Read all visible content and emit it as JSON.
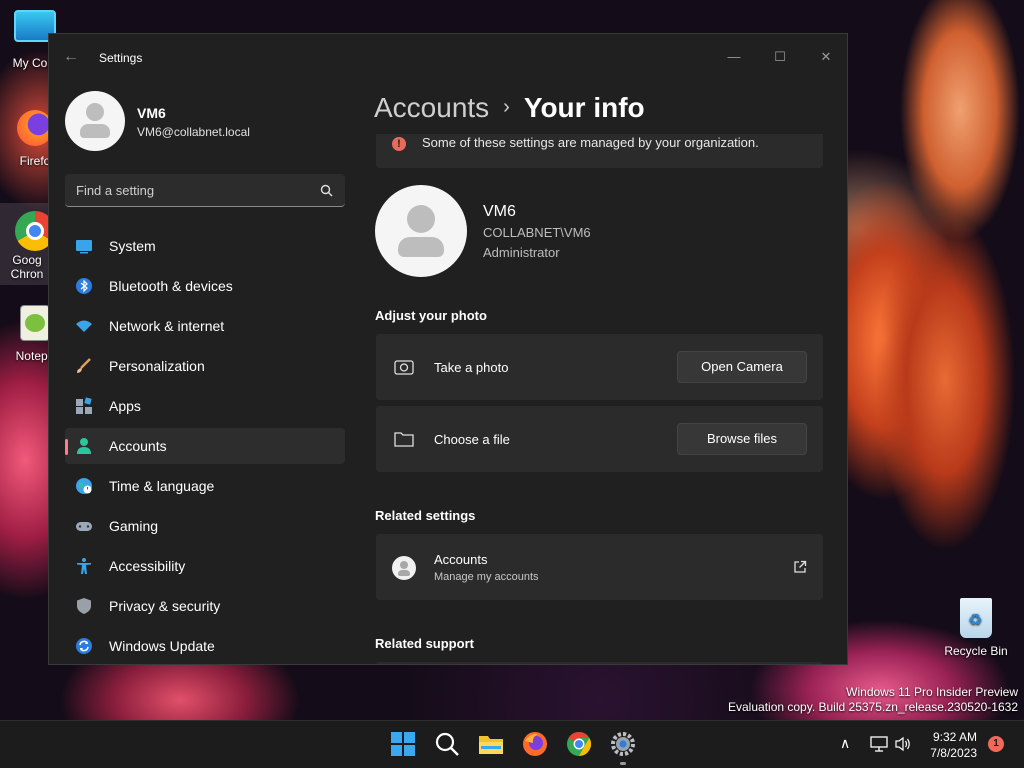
{
  "desktop": {
    "icons": [
      {
        "label": "My Com",
        "icon": "monitor-icon"
      },
      {
        "label": "Firefo",
        "icon": "firefox-icon"
      },
      {
        "label": "Goog",
        "label2": "Chron",
        "icon": "chrome-icon"
      },
      {
        "label": "Notepa",
        "icon": "notepad-icon"
      },
      {
        "label": "Recycle Bin",
        "icon": "recycle-bin-icon"
      }
    ],
    "watermark": {
      "line1": "Windows 11 Pro Insider Preview",
      "line2": "Evaluation copy. Build 25375.zn_release.230520-1632"
    }
  },
  "window": {
    "title": "Settings",
    "controls": {
      "minimize": "—",
      "maximize": "☐",
      "close": "✕"
    }
  },
  "profile": {
    "name": "VM6",
    "email": "VM6@collabnet.local"
  },
  "search": {
    "placeholder": "Find a setting"
  },
  "nav": {
    "items": [
      {
        "label": "System",
        "icon": "system-icon"
      },
      {
        "label": "Bluetooth & devices",
        "icon": "bluetooth-icon"
      },
      {
        "label": "Network & internet",
        "icon": "wifi-icon"
      },
      {
        "label": "Personalization",
        "icon": "brush-icon"
      },
      {
        "label": "Apps",
        "icon": "apps-icon"
      },
      {
        "label": "Accounts",
        "icon": "accounts-icon",
        "selected": true
      },
      {
        "label": "Time & language",
        "icon": "globe-icon"
      },
      {
        "label": "Gaming",
        "icon": "gamepad-icon"
      },
      {
        "label": "Accessibility",
        "icon": "accessibility-icon"
      },
      {
        "label": "Privacy & security",
        "icon": "shield-icon"
      },
      {
        "label": "Windows Update",
        "icon": "update-icon"
      }
    ]
  },
  "main": {
    "breadcrumb": {
      "parent": "Accounts",
      "separator": "›",
      "current": "Your info"
    },
    "org_notice": "Some of these settings are managed by your organization.",
    "user": {
      "name": "VM6",
      "account": "COLLABNET\\VM6",
      "role": "Administrator"
    },
    "adjust_photo": {
      "header": "Adjust your photo",
      "take_photo": {
        "label": "Take a photo",
        "button": "Open Camera"
      },
      "choose_file": {
        "label": "Choose a file",
        "button": "Browse files"
      }
    },
    "related_settings": {
      "header": "Related settings",
      "accounts": {
        "label": "Accounts",
        "sublabel": "Manage my accounts"
      }
    },
    "related_support": {
      "header": "Related support"
    }
  },
  "taskbar": {
    "apps": [
      "start-icon",
      "search-icon",
      "file-explorer-icon",
      "firefox-icon",
      "chrome-icon",
      "settings-icon"
    ],
    "clock": {
      "time": "9:32 AM",
      "date": "7/8/2023"
    },
    "notification_count": "1"
  },
  "colors": {
    "accent": "#ff7a8a",
    "window_bg": "#202020",
    "card_bg": "#2b2b2b"
  }
}
